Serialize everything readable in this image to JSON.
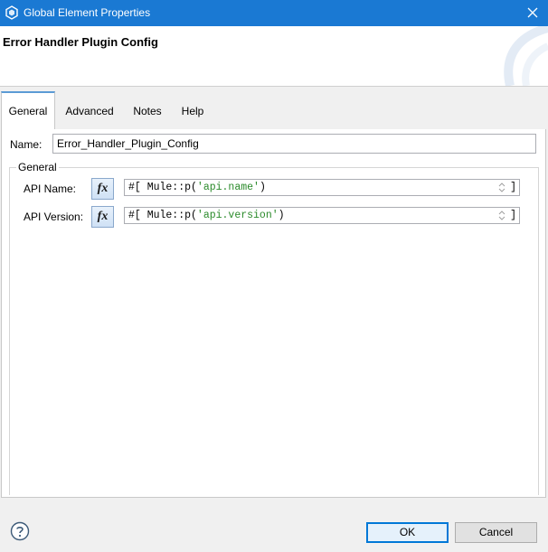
{
  "window": {
    "title": "Global Element Properties",
    "accent_color": "#1a79d3"
  },
  "header": {
    "heading": "Error Handler Plugin Config"
  },
  "tabs": [
    {
      "label": "General",
      "active": true
    },
    {
      "label": "Advanced",
      "active": false
    },
    {
      "label": "Notes",
      "active": false
    },
    {
      "label": "Help",
      "active": false
    }
  ],
  "form": {
    "name_label": "Name:",
    "name_value": "Error_Handler_Plugin_Config",
    "group_label": "General",
    "fields": [
      {
        "label": "API Name:",
        "fx": "fx",
        "prefix": "#[ Mule::p(",
        "string": "'api.name'",
        "suffix": ")",
        "close": "]"
      },
      {
        "label": "API Version:",
        "fx": "fx",
        "prefix": "#[ Mule::p(",
        "string": "'api.version'",
        "suffix": ")",
        "close": "]"
      }
    ]
  },
  "footer": {
    "help_icon": "question-circle-icon",
    "ok_label": "OK",
    "cancel_label": "Cancel"
  }
}
